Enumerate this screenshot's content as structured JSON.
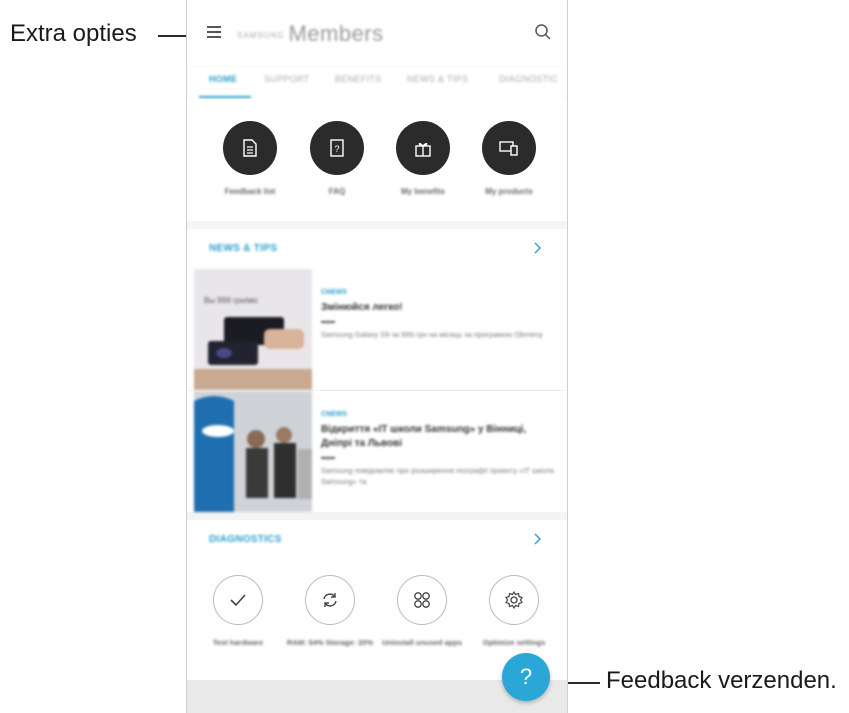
{
  "callouts": {
    "menu": "Extra opties",
    "feedback": "Feedback verzenden."
  },
  "app": {
    "brand": "SAMSUNG",
    "title": "Members"
  },
  "tabs": [
    "HOME",
    "SUPPORT",
    "BENEFITS",
    "NEWS & TIPS",
    "DIAGNOSTIC"
  ],
  "quick_actions": [
    {
      "label": "Feedback list",
      "icon": "document-icon"
    },
    {
      "label": "FAQ",
      "icon": "faq-icon"
    },
    {
      "label": "My benefits",
      "icon": "gift-icon"
    },
    {
      "label": "My products",
      "icon": "devices-icon"
    }
  ],
  "news_section": {
    "title": "NEWS & TIPS",
    "items": [
      {
        "tag": "CNEWS",
        "title": "Змінюйся легко!",
        "body": "Samsung Galaxy S9 за 999 грн на місяць за програмою Obmeny",
        "thumb_text": "Вы 999 грн/міс"
      },
      {
        "tag": "CNEWS",
        "title": "Відкриття «IT школи Samsung» у Вінниці, Дніпрі та Львові",
        "body": "Samsung повідомляє про розширення географії проекту «IT школа Samsung» та",
        "thumb_text": ""
      }
    ]
  },
  "diagnostics": {
    "title": "DIAGNOSTICS",
    "items": [
      {
        "label": "Test hardware",
        "icon": "check-icon"
      },
      {
        "label": "RAM: 54% Storage: 20%",
        "icon": "refresh-icon"
      },
      {
        "label": "Uninstall unused apps",
        "icon": "apps-grid-icon"
      },
      {
        "label": "Optimize settings",
        "icon": "settings-icon"
      }
    ]
  },
  "fab": {
    "glyph": "?"
  },
  "colors": {
    "accent": "#2aa7d6",
    "dark_circle": "#2b2b2b"
  }
}
